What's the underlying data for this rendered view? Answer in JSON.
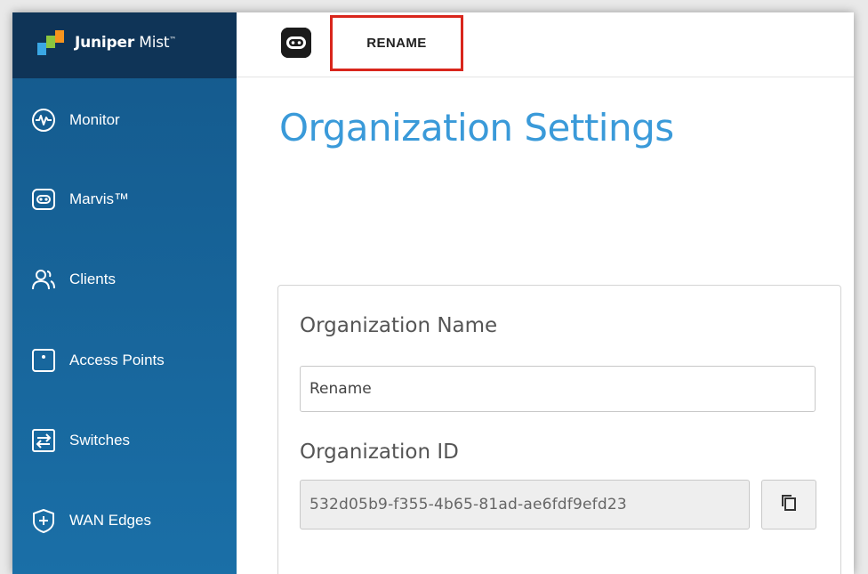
{
  "brand": {
    "name_bold": "Juniper",
    "name_light": "Mist",
    "trademark": "™"
  },
  "sidebar": {
    "items": [
      {
        "label": "Monitor",
        "icon": "monitor-pulse-icon"
      },
      {
        "label": "Marvis™",
        "icon": "marvis-icon"
      },
      {
        "label": "Clients",
        "icon": "clients-icon"
      },
      {
        "label": "Access Points",
        "icon": "access-point-icon"
      },
      {
        "label": "Switches",
        "icon": "switch-icon"
      },
      {
        "label": "WAN Edges",
        "icon": "wan-edge-icon"
      }
    ]
  },
  "header": {
    "org_name": "RENAME",
    "org_avatar_icon": "marvis-robot-icon"
  },
  "main": {
    "title": "Organization Settings",
    "org_name_label": "Organization Name",
    "org_name_value": "Rename",
    "org_id_label": "Organization ID",
    "org_id_value": "532d05b9-f355-4b65-81ad-ae6fdf9efd23",
    "copy_icon": "copy-icon"
  },
  "colors": {
    "accent": "#3a9ad9",
    "sidebar": "#14598c",
    "brand_bar": "#0f3457",
    "highlight": "#d9261c"
  }
}
